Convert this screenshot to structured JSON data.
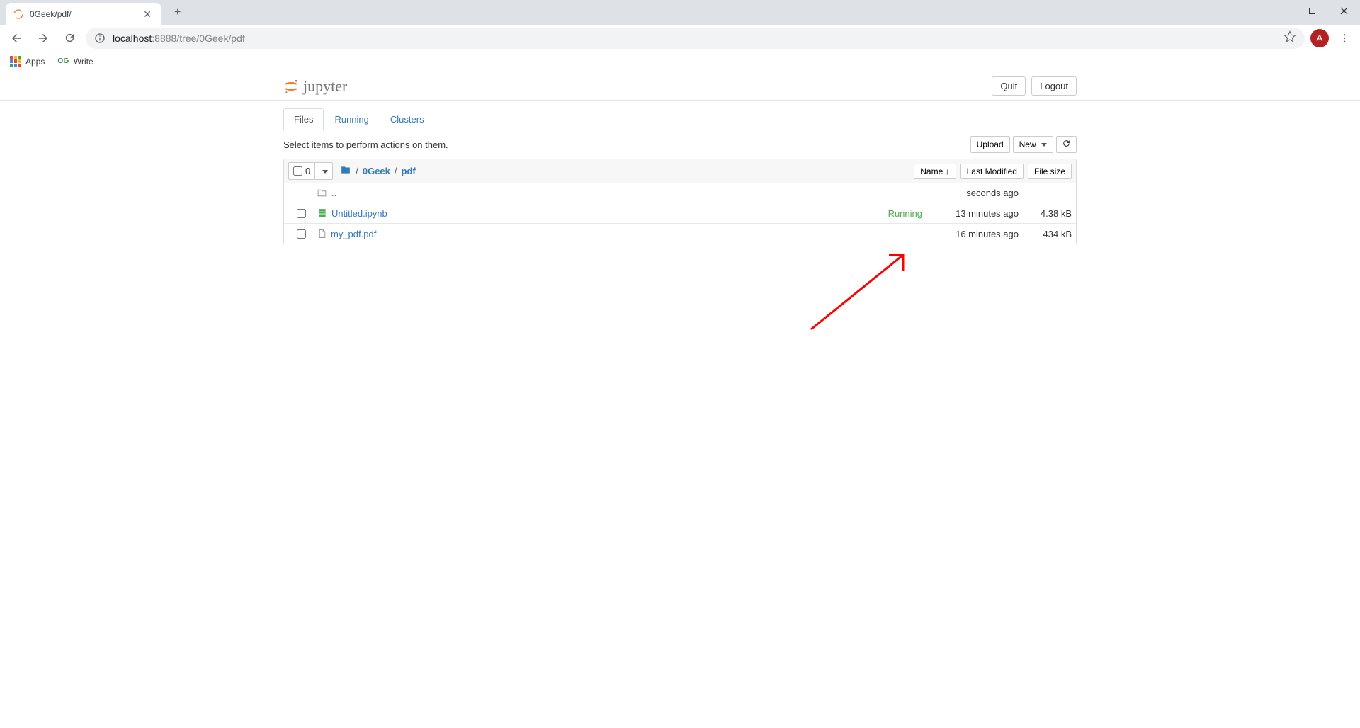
{
  "browser": {
    "tab_title": "0Geek/pdf/",
    "url_host": "localhost",
    "url_port": ":8888",
    "url_path": "/tree/0Geek/pdf",
    "avatar_letter": "A",
    "bookmarks": {
      "apps": "Apps",
      "write": "Write"
    }
  },
  "header": {
    "logo_text": "jupyter",
    "quit": "Quit",
    "logout": "Logout"
  },
  "tabs": {
    "files": "Files",
    "running": "Running",
    "clusters": "Clusters"
  },
  "toolbar": {
    "hint": "Select items to perform actions on them.",
    "upload": "Upload",
    "new": "New"
  },
  "list_header": {
    "count": "0",
    "name": "Name",
    "last_modified": "Last Modified",
    "file_size": "File size"
  },
  "breadcrumb": {
    "folder1": "0Geek",
    "folder2": "pdf"
  },
  "rows": {
    "parent": {
      "name": "..",
      "modified": "seconds ago",
      "size": ""
    },
    "r1": {
      "name": "Untitled.ipynb",
      "status": "Running",
      "modified": "13 minutes ago",
      "size": "4.38 kB"
    },
    "r2": {
      "name": "my_pdf.pdf",
      "modified": "16 minutes ago",
      "size": "434 kB"
    }
  }
}
